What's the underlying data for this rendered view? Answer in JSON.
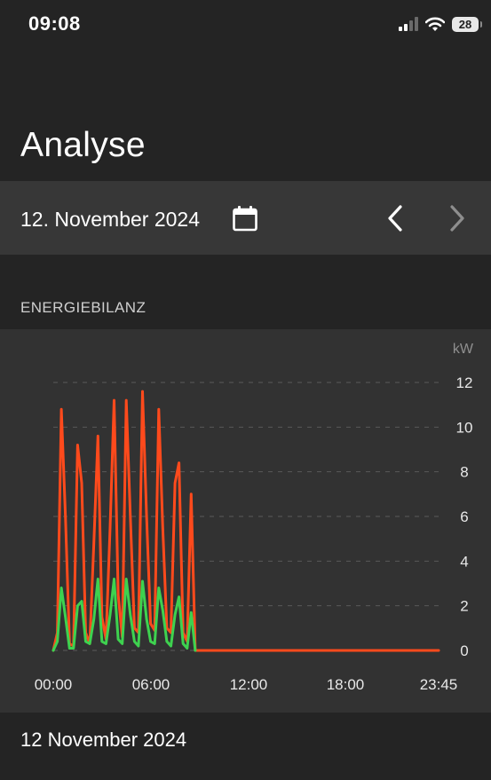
{
  "status_bar": {
    "time": "09:08",
    "battery": "28",
    "icons": [
      "signal-icon",
      "wifi-icon",
      "battery-icon"
    ]
  },
  "header": {
    "title": "Analyse"
  },
  "date_nav": {
    "date": "12. November 2024",
    "icons": [
      "calendar-icon",
      "chevron-left-icon",
      "chevron-right-icon"
    ]
  },
  "section": {
    "title": "ENERGIEBILANZ"
  },
  "footer": {
    "date": "12 November 2024"
  },
  "colors": {
    "background": "#242424",
    "panel": "#373737",
    "chart_background": "#323232",
    "series_red": "#ff4a1c",
    "series_green": "#3ed24f"
  },
  "chart_data": {
    "type": "line",
    "unit": "kW",
    "x_ticks": [
      "00:00",
      "06:00",
      "12:00",
      "18:00",
      "23:45"
    ],
    "xlim": [
      0,
      23.75
    ],
    "y_ticks": [
      0,
      2,
      4,
      6,
      8,
      10,
      12
    ],
    "ylim": [
      0,
      12
    ],
    "grid": true,
    "y_axis_position": "right",
    "series": [
      {
        "color": "#ff4a1c",
        "x": [
          0,
          0.25,
          0.5,
          0.75,
          1,
          1.25,
          1.5,
          1.75,
          2,
          2.25,
          2.5,
          2.75,
          3,
          3.25,
          3.5,
          3.75,
          4,
          4.25,
          4.5,
          4.75,
          5,
          5.25,
          5.5,
          5.75,
          6,
          6.25,
          6.5,
          6.75,
          7,
          7.25,
          7.5,
          7.75,
          8,
          8.25,
          8.5,
          8.75,
          9,
          9.25,
          23.75
        ],
        "values": [
          0,
          0.8,
          10.8,
          6.0,
          0.3,
          0.2,
          9.2,
          7.5,
          0.8,
          0.3,
          4.8,
          9.6,
          1.5,
          0.5,
          5.5,
          11.2,
          2.5,
          0.6,
          11.2,
          6.0,
          1.0,
          0.8,
          11.6,
          6.0,
          1.2,
          0.9,
          10.8,
          5.5,
          1.0,
          0.8,
          7.5,
          8.4,
          0.8,
          0.4,
          7.0,
          0,
          0,
          0,
          0
        ]
      },
      {
        "color": "#3ed24f",
        "x": [
          0,
          0.25,
          0.5,
          0.75,
          1,
          1.25,
          1.5,
          1.75,
          2,
          2.25,
          2.5,
          2.75,
          3,
          3.25,
          3.5,
          3.75,
          4,
          4.25,
          4.5,
          4.75,
          5,
          5.25,
          5.5,
          5.75,
          6,
          6.25,
          6.5,
          6.75,
          7,
          7.25,
          7.5,
          7.75,
          8,
          8.25,
          8.5,
          8.75
        ],
        "values": [
          0,
          0.4,
          2.8,
          1.5,
          0.1,
          0.1,
          2.0,
          2.2,
          0.4,
          0.3,
          1.4,
          3.2,
          0.4,
          0.3,
          1.6,
          3.2,
          0.5,
          0.3,
          3.2,
          1.6,
          0.4,
          0.2,
          3.1,
          1.4,
          0.4,
          0.3,
          2.8,
          1.8,
          0.4,
          0.2,
          1.6,
          2.4,
          0.3,
          0.1,
          1.7,
          0
        ]
      }
    ]
  }
}
